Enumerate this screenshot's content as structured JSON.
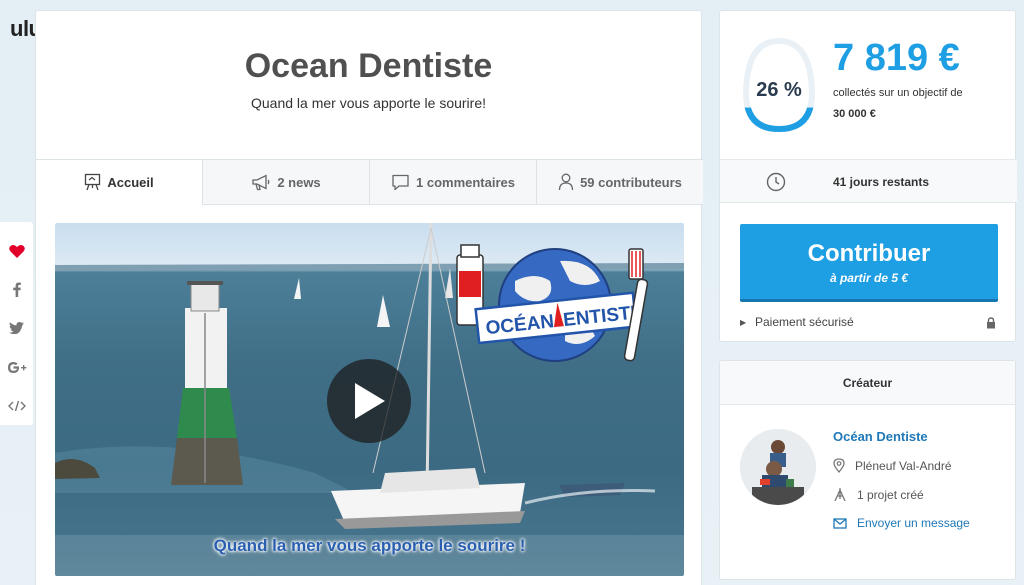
{
  "brand": {
    "name": "ulule"
  },
  "share": {
    "items": [
      {
        "icon": "heart-icon",
        "label": "♥"
      },
      {
        "icon": "facebook-icon",
        "label": "f"
      },
      {
        "icon": "twitter-icon",
        "label": "t"
      },
      {
        "icon": "google-plus-icon",
        "label": "G+"
      },
      {
        "icon": "embed-icon",
        "label": "</>"
      }
    ]
  },
  "project": {
    "title": "Ocean Dentiste",
    "subtitle": "Quand la mer vous apporte le sourire!"
  },
  "tabs": [
    {
      "label": "Accueil",
      "icon": "easel-icon",
      "active": true
    },
    {
      "label": "2 news",
      "icon": "megaphone-icon",
      "active": false
    },
    {
      "label": "1 commentaires",
      "icon": "speech-bubble-icon",
      "active": false
    },
    {
      "label": "59 contributeurs",
      "icon": "person-icon",
      "active": false
    }
  ],
  "video": {
    "caption": "Quand la mer vous apporte le sourire !",
    "logo_text_left": "OCÉAN",
    "logo_text_right": "ENTISTE"
  },
  "funding": {
    "percent": "26 %",
    "progress_fraction": 0.26,
    "amount": "7 819 €",
    "collected_label": "collectés sur un objectif de",
    "goal": "30 000 €",
    "days_left": "41 jours restants",
    "contribute_label": "Contribuer",
    "contribute_sub": "à partir de 5 €",
    "secure_label": "Paiement sécurisé"
  },
  "creator": {
    "header": "Créateur",
    "name": "Océan Dentiste",
    "location": "Pléneuf Val-André",
    "projects": "1 projet créé",
    "message": "Envoyer un message"
  },
  "colors": {
    "accent": "#1e9ee3",
    "link": "#1e78b8",
    "heart": "#e2002b"
  }
}
